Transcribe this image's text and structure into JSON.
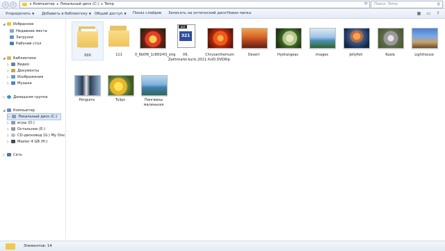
{
  "address": {
    "crumbs": [
      "Компьютер",
      "Локальный диск (C:)",
      "Temp"
    ],
    "search_placeholder": "Поиск: Temp"
  },
  "toolbar": {
    "organize": "Упорядочить",
    "add_library": "Добавить в библиотеку",
    "share": "Общий доступ",
    "slideshow": "Показ слайдов",
    "burn": "Записать на оптический диск",
    "new_folder": "Новая папка"
  },
  "nav": {
    "favorites": "Избранное",
    "recent": "Недавние места",
    "downloads": "Загрузки",
    "desktop": "Рабочий стол",
    "libraries": "Библиотеки",
    "video": "Видео",
    "documents": "Документы",
    "pictures": "Изображения",
    "music": "Музыка",
    "homegroup": "Домашняя группа",
    "computer": "Компьютер",
    "drive_c": "Локальный диск (C:)",
    "drive_d": "игры (D:)",
    "drive_e": "Остальное (E:)",
    "drive_g": "CD-дисковод (G:) My Disc",
    "drive_h": "Master 4 GB (H:)",
    "network": "Сеть"
  },
  "files": [
    {
      "name": "000",
      "type": "folder"
    },
    {
      "name": "111",
      "type": "folder"
    },
    {
      "name": "0_6b0f6_1c891f43_orig",
      "type": "image"
    },
    {
      "name": "09. Zakhmatel.kuric.2011.XviD.DVDRip",
      "type": "video"
    },
    {
      "name": "Chrysanthemum",
      "type": "image"
    },
    {
      "name": "Desert",
      "type": "image"
    },
    {
      "name": "Hydrangeas",
      "type": "image"
    },
    {
      "name": "images",
      "type": "image"
    },
    {
      "name": "Jellyfish",
      "type": "image"
    },
    {
      "name": "Koala",
      "type": "image"
    },
    {
      "name": "Lighthouse",
      "type": "image"
    },
    {
      "name": "Penguins",
      "type": "image"
    },
    {
      "name": "Tulips",
      "type": "image"
    },
    {
      "name": "Пингвины маленькая",
      "type": "image"
    }
  ],
  "video_badge": {
    "ext": "avi",
    "digits": "321"
  },
  "status": {
    "count": "Элементов: 14"
  }
}
